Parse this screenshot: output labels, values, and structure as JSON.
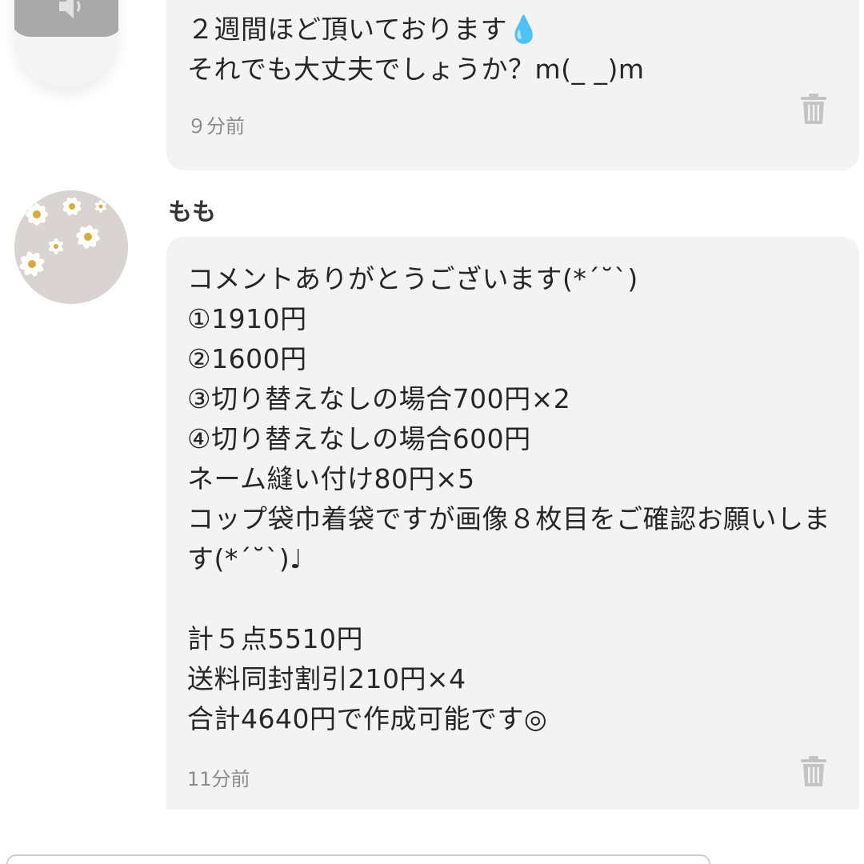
{
  "messages": [
    {
      "text": "２週間ほど頂いております💧\nそれでも大丈夫でしょうか？m(_ _)m",
      "time": "９分前",
      "delete_icon": "trash-icon"
    },
    {
      "user": "もも",
      "avatar": "daisy-avatar",
      "text": "コメントありがとうございます(*´˘`)\n①1910円\n②1600円\n③切り替えなしの場合700円×2\n④切り替えなしの場合600円\nネーム縫い付け80円×5\nコップ袋巾着袋ですが画像８枚目をご確認お願いします(*´˘`)♩\n\n計５点5510円\n送料同封割引210円×4\n合計4640円で作成可能です◎",
      "time": "11分前",
      "delete_icon": "trash-icon"
    }
  ],
  "top_avatar_icon": "speaker-icon",
  "colors": {
    "bubble_bg": "#f3f3f3",
    "time_text": "#8a8a8a",
    "icon_gray": "#c4c4c4"
  }
}
